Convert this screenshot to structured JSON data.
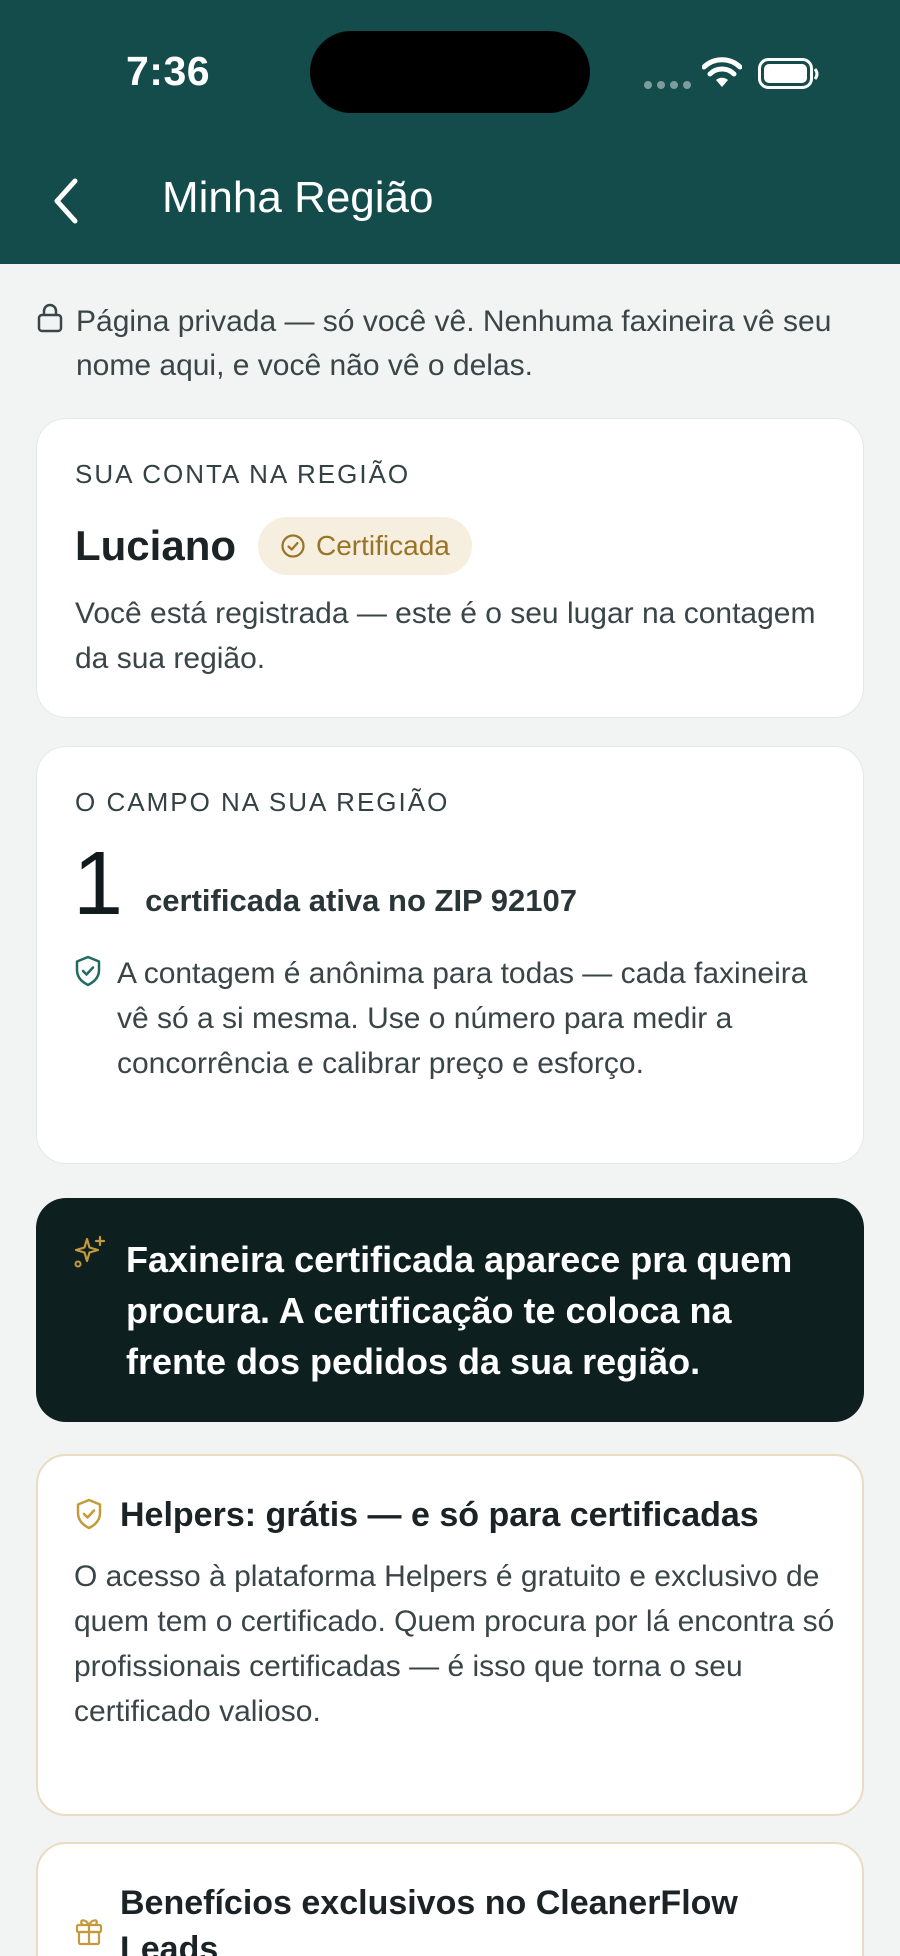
{
  "status_bar": {
    "time": "7:36"
  },
  "header": {
    "title": "Minha Região"
  },
  "privacy_notice": "Página privada — só você vê. Nenhuma faxineira vê seu nome aqui, e você não vê o delas.",
  "account_card": {
    "eyebrow": "SUA CONTA NA REGIÃO",
    "name": "Luciano",
    "badge": "Certificada",
    "text": "Você está registrada — este é o seu lugar na contagem da sua região."
  },
  "field_card": {
    "eyebrow": "O CAMPO NA SUA REGIÃO",
    "count": "1",
    "count_label": "certificada ativa no ZIP 92107",
    "note": "A contagem é anônima para todas — cada faxineira vê só a si mesma. Use o número para medir a concorrência e calibrar preço e esforço."
  },
  "promo": {
    "text": "Faxineira certificada aparece pra quem procura. A certificação te coloca na frente dos pedidos da sua região."
  },
  "helpers_card": {
    "title": "Helpers: grátis — e só para certificadas",
    "body": "O acesso à plataforma Helpers é gratuito e exclusivo de quem tem o certificado. Quem procura por lá encontra só profissionais certificadas — é isso que torna o seu certificado valioso."
  },
  "benefits_card": {
    "title": "Benefícios exclusivos no CleanerFlow Leads"
  },
  "colors": {
    "header": "#134c4b",
    "promo_bg": "#0d1f1f",
    "badge_bg": "#f6efe0",
    "badge_text": "#9a7426",
    "accent_icon": "#c49a3a",
    "teal_icon": "#1f6b62"
  },
  "icons": {
    "back": "chevron-left-icon",
    "lock": "lock-icon",
    "badge": "check-circle-icon",
    "shield": "shield-check-icon",
    "sparkles": "sparkles-icon",
    "gift": "gift-icon"
  }
}
